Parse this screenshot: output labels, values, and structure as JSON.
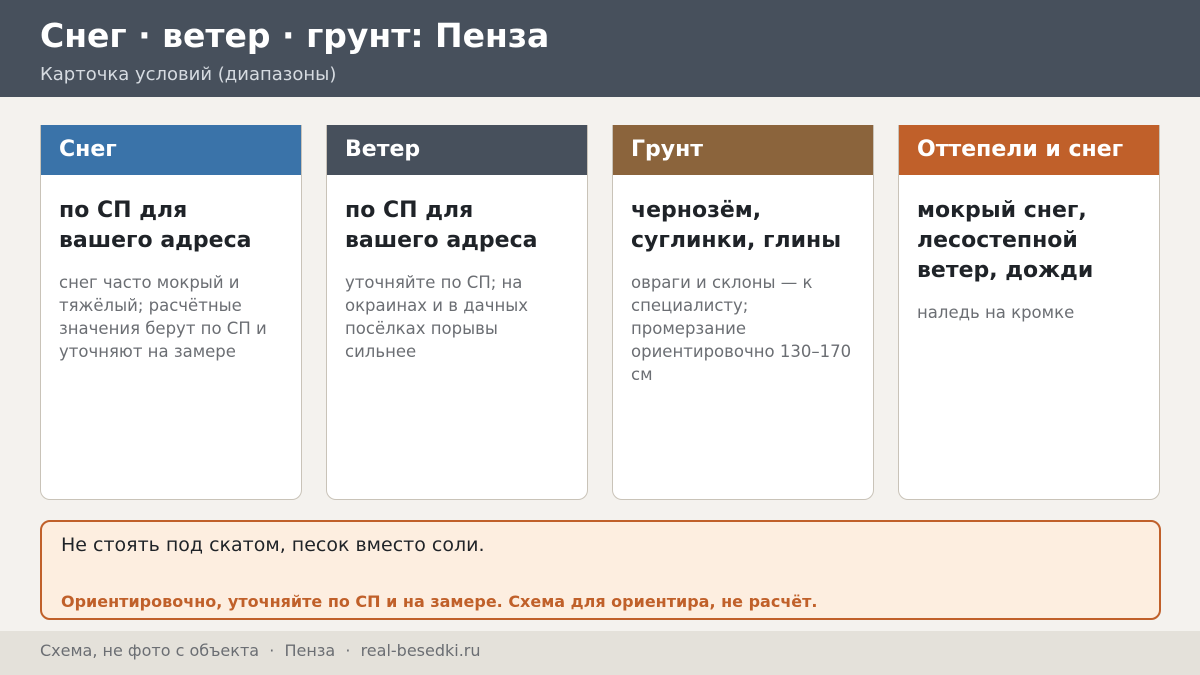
{
  "header": {
    "title": "Снег · ветер · грунт: Пенза",
    "subtitle": "Карточка условий (диапазоны)"
  },
  "colors": {
    "header_bg": "#47505c",
    "snow": "#3a73a9",
    "wind": "#47505c",
    "soil": "#8b643c",
    "thaw": "#c0602a",
    "notice_bg": "#fdeee0",
    "accent": "#c0602a"
  },
  "cards": [
    {
      "title": "Снег",
      "main": "по СП для вашего адреса",
      "note": "снег часто мокрый и тяжёлый; расчётные значения берут по СП и уточняют на замере"
    },
    {
      "title": "Ветер",
      "main": "по СП для вашего адреса",
      "note": "уточняйте по СП; на окраинах и в дачных посёлках порывы сильнее"
    },
    {
      "title": "Грунт",
      "main": "чернозём, суглинки, глины",
      "note": "овраги и склоны — к специалисту; промерзание ориентировочно 130–170 см"
    },
    {
      "title": "Оттепели и снег",
      "main": "мокрый снег, лесостепной ветер, дожди",
      "note": "наледь на кромке"
    }
  ],
  "notice": {
    "text": "Не стоять под скатом, песок вместо соли.",
    "warning": "Ориентировочно, уточняйте по СП и на замере. Схема для ориентира, не расчёт."
  },
  "footer": {
    "text": "Схема, не фото с объекта  ·  Пенза  ·  real-besedki.ru"
  }
}
